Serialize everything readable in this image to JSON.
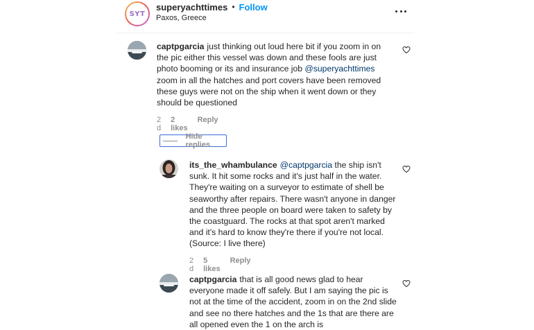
{
  "post_header": {
    "logo_text": "SYT",
    "username": "superyachttimes",
    "separator": "•",
    "follow_label": "Follow",
    "location": "Paxos, Greece"
  },
  "comments": [
    {
      "username": "captpgarcia",
      "text_before": "just thinking out loud here bit if you zoom in on the pic either this vessel was down and these fools are just photo booming or its and insurance job ",
      "mention": "@superyachttimes",
      "text_after": " zoom in all the hatches and port covers have been removed these guys were not on the ship when it went down or they should be questioned",
      "time": "2 d",
      "likes": "2 likes",
      "reply_label": "Reply"
    }
  ],
  "hide_replies_label": "Hide replies",
  "replies": [
    {
      "username": "its_the_whambulance",
      "mention": "@captpgarcia",
      "text": " the ship isn't sunk. It hit some rocks and it's just half in the water. They're waiting on a surveyor to estimate of shell be seaworthy after repairs. There wasn't anyone in danger and the three people on board were taken to safety by the coastguard. The rocks at that spot aren't marked and it's hard to know they're there if you're not local. (Source: I live there)",
      "time": "2 d",
      "likes": "5 likes",
      "reply_label": "Reply"
    },
    {
      "username": "captpgarcia",
      "text": "that is all good news glad to hear everyone made it off safely. But I am saying the pic is not at the time of the accident, zoom in on the 2nd slide and see no there hatches and the 1s that are there are all opened even the 1 on the arch is"
    }
  ],
  "icons": {
    "more": "more-options-icon",
    "heart": "heart-icon"
  },
  "colors": {
    "link_blue": "#0095f6",
    "mention": "#00376b",
    "muted": "#8e8e8e",
    "text": "#262626"
  }
}
